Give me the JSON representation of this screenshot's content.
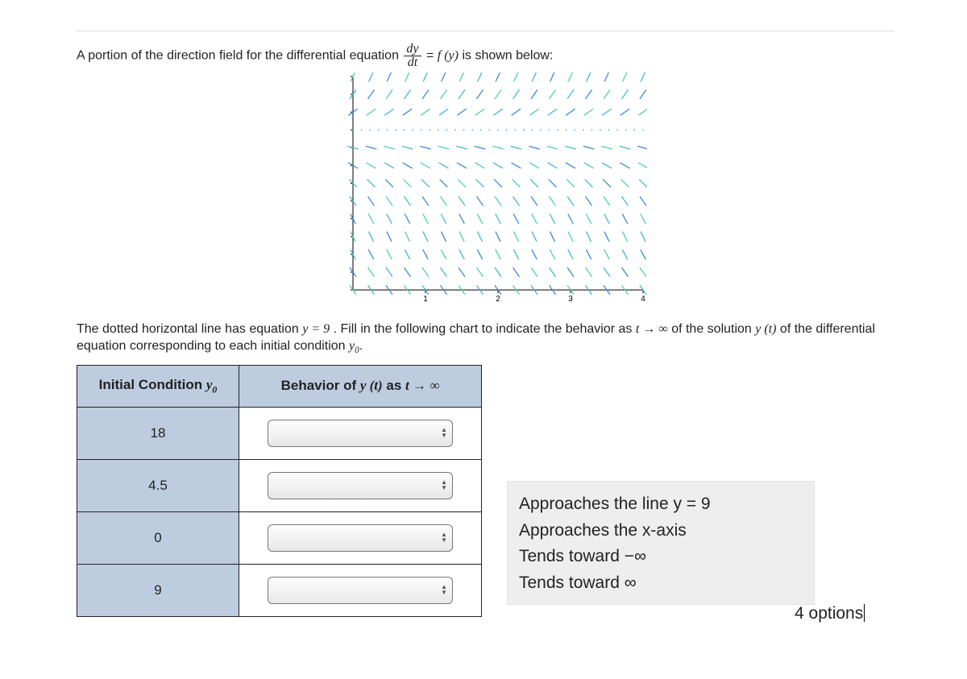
{
  "intro": {
    "pre": "A portion of the direction field for the differential equation ",
    "frac_num": "dy",
    "frac_den": "dt",
    "mid": " = ",
    "fn": "f (y)",
    "post": " is shown below:"
  },
  "explain": {
    "pre": "The dotted horizontal line has equation ",
    "eq": "y = 9",
    "mid1": ". Fill in the following chart to indicate the behavior as ",
    "lim": "t → ∞",
    "mid2": " of the solution ",
    "sol": "y (t)",
    "post": " of the differential equation corresponding to each initial condition ",
    "y0": "y",
    "y0sub": "0",
    "period": "."
  },
  "table": {
    "head_a_pre": "Initial Condition ",
    "head_a_var": "y",
    "head_a_sub": "0",
    "head_b_pre": "Behavior of ",
    "head_b_var": "y (t)",
    "head_b_mid": " as ",
    "head_b_lim": "t → ∞",
    "rows": [
      {
        "ic": "18"
      },
      {
        "ic": "4.5"
      },
      {
        "ic": "0"
      },
      {
        "ic": "9"
      }
    ]
  },
  "options": {
    "items": [
      "Approaches the line y = 9",
      "Approaches the x-axis",
      "Tends toward −∞",
      "Tends toward ∞"
    ],
    "caption": "4 options"
  },
  "chart_data": {
    "type": "direction-field",
    "x_range": [
      0,
      4
    ],
    "x_ticks": [
      1,
      2,
      3,
      4
    ],
    "y_range": [
      0,
      12
    ],
    "equilibria": [
      0,
      9
    ],
    "dotted_line_y": 9,
    "slope_sign": [
      {
        "region": "y > 9",
        "sign": "positive"
      },
      {
        "region": "y = 9",
        "sign": "zero"
      },
      {
        "region": "0 < y < 9",
        "sign": "negative"
      },
      {
        "region": "y = 0",
        "sign": "zero"
      }
    ],
    "rows": [
      {
        "y": 12,
        "angle_deg": 65
      },
      {
        "y": 11,
        "angle_deg": 55
      },
      {
        "y": 10,
        "angle_deg": 35
      },
      {
        "y": 9,
        "angle_deg": 0,
        "style": "dotted"
      },
      {
        "y": 8,
        "angle_deg": -15
      },
      {
        "y": 7,
        "angle_deg": -30
      },
      {
        "y": 6,
        "angle_deg": -45
      },
      {
        "y": 5,
        "angle_deg": -55
      },
      {
        "y": 4,
        "angle_deg": -62
      },
      {
        "y": 3,
        "angle_deg": -64
      },
      {
        "y": 2,
        "angle_deg": -62
      },
      {
        "y": 1,
        "angle_deg": -55
      },
      {
        "y": 0,
        "angle_deg": -55
      }
    ],
    "cols_per_unit": 4,
    "segment_colors": [
      "#4bd4a5",
      "#42b8d4",
      "#3a8be0"
    ]
  }
}
